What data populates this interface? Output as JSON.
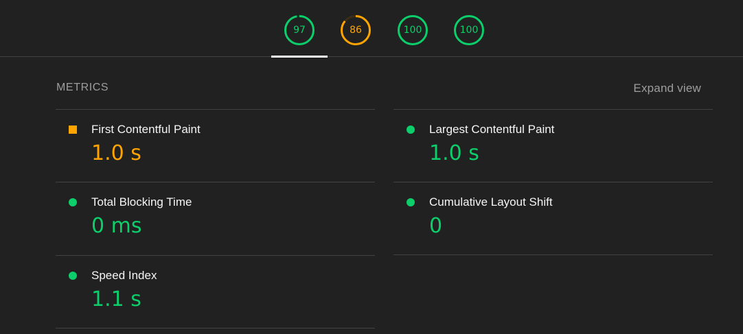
{
  "colors": {
    "pass": "#0cce6b",
    "average": "#ffa400",
    "gauge_track_pass": "#0b3b22",
    "gauge_track_average": "#3d2e12"
  },
  "gauges": [
    {
      "score": "97",
      "status": "pass",
      "fraction": 0.97
    },
    {
      "score": "86",
      "status": "average",
      "fraction": 0.86
    },
    {
      "score": "100",
      "status": "pass",
      "fraction": 1.0
    },
    {
      "score": "100",
      "status": "pass",
      "fraction": 1.0
    }
  ],
  "metrics_section": {
    "title": "METRICS",
    "expand_label": "Expand view"
  },
  "metrics": [
    {
      "label": "First Contentful Paint",
      "value": "1.0 s",
      "status": "average",
      "icon": "square-icon"
    },
    {
      "label": "Largest Contentful Paint",
      "value": "1.0 s",
      "status": "pass",
      "icon": "circle-icon"
    },
    {
      "label": "Total Blocking Time",
      "value": "0 ms",
      "status": "pass",
      "icon": "circle-icon"
    },
    {
      "label": "Cumulative Layout Shift",
      "value": "0",
      "status": "pass",
      "icon": "circle-icon"
    },
    {
      "label": "Speed Index",
      "value": "1.1 s",
      "status": "pass",
      "icon": "circle-icon"
    }
  ]
}
